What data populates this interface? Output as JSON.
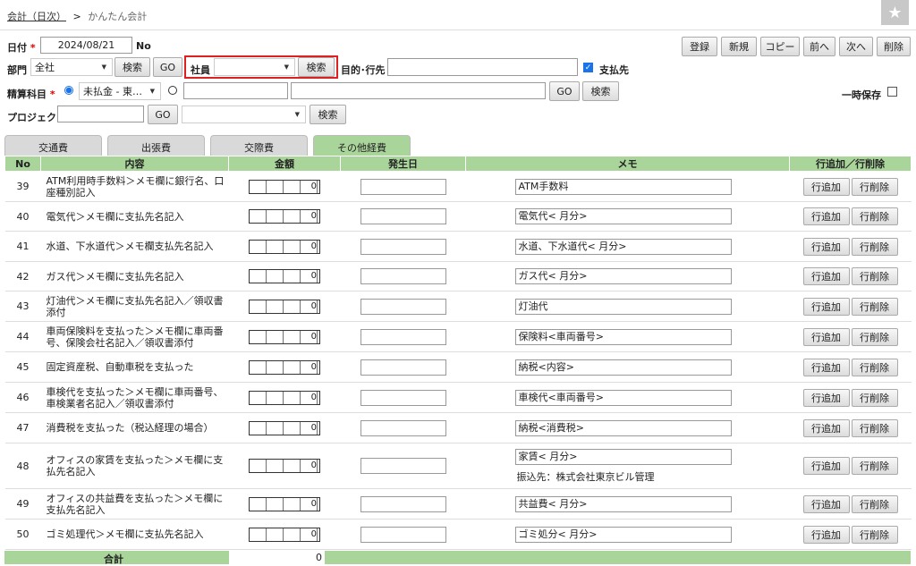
{
  "breadcrumb": {
    "parent": "会計（日次）",
    "sep": ">",
    "current": "かんたん会計"
  },
  "form": {
    "date_label": "日付",
    "date_value": "2024/08/21",
    "no_label": "No",
    "dept_label": "部門",
    "dept_value": "全社",
    "search": "検索",
    "go": "GO",
    "employee_label": "社員",
    "employee_value": "",
    "purpose_label": "目的･行先",
    "purpose_value": "",
    "payee_label": "支払先",
    "account_label": "精算科目",
    "account_value": "未払金 - 東…",
    "temp_save_label": "一時保存",
    "project_label": "プロジェクト"
  },
  "toolbar": [
    "登録",
    "新規",
    "コピー",
    "前へ",
    "次へ",
    "削除"
  ],
  "tabs": [
    "交通費",
    "出張費",
    "交際費",
    "その他経費"
  ],
  "table": {
    "headers": [
      "No",
      "内容",
      "金額",
      "発生日",
      "メモ",
      "行追加／行削除"
    ],
    "add": "行追加",
    "del": "行削除",
    "rows": [
      {
        "no": "39",
        "desc": "ATM利用時手数料＞メモ欄に銀行名、口座種別記入",
        "amount": "0",
        "memo": "ATM手数料",
        "memo2": ""
      },
      {
        "no": "40",
        "desc": "電気代＞メモ欄に支払先名記入",
        "amount": "0",
        "memo": "電気代<  月分>",
        "memo2": ""
      },
      {
        "no": "41",
        "desc": "水道、下水道代＞メモ欄支払先名記入",
        "amount": "0",
        "memo": "水道、下水道代<  月分>",
        "memo2": ""
      },
      {
        "no": "42",
        "desc": "ガス代＞メモ欄に支払先名記入",
        "amount": "0",
        "memo": "ガス代<  月分>",
        "memo2": ""
      },
      {
        "no": "43",
        "desc": "灯油代＞メモ欄に支払先名記入／領収書添付",
        "amount": "0",
        "memo": "灯油代",
        "memo2": ""
      },
      {
        "no": "44",
        "desc": "車両保険料を支払った＞メモ欄に車両番号、保険会社名記入／領収書添付",
        "amount": "0",
        "memo": "保険料<車両番号>",
        "memo2": ""
      },
      {
        "no": "45",
        "desc": "固定資産税、自動車税を支払った",
        "amount": "0",
        "memo": "納税<内容>",
        "memo2": ""
      },
      {
        "no": "46",
        "desc": "車検代を支払った＞メモ欄に車両番号、車検業者名記入／領収書添付",
        "amount": "0",
        "memo": "車検代<車両番号>",
        "memo2": ""
      },
      {
        "no": "47",
        "desc": "消費税を支払った（税込経理の場合）",
        "amount": "0",
        "memo": "納税<消費税>",
        "memo2": ""
      },
      {
        "no": "48",
        "desc": "オフィスの家賃を支払った＞メモ欄に支払先名記入",
        "amount": "0",
        "memo": "家賃<  月分>",
        "memo2": "振込先：株式会社東京ビル管理"
      },
      {
        "no": "49",
        "desc": "オフィスの共益費を支払った＞メモ欄に支払先名記入",
        "amount": "0",
        "memo": "共益費<  月分>",
        "memo2": ""
      },
      {
        "no": "50",
        "desc": "ゴミ処理代＞メモ欄に支払先名記入",
        "amount": "0",
        "memo": "ゴミ処分<  月分>",
        "memo2": ""
      }
    ]
  },
  "total": {
    "label": "合計",
    "value": "0"
  },
  "colors": {
    "accent_green": "#a9d59b",
    "highlight_red": "#e02020",
    "check_blue": "#1a73e8"
  }
}
